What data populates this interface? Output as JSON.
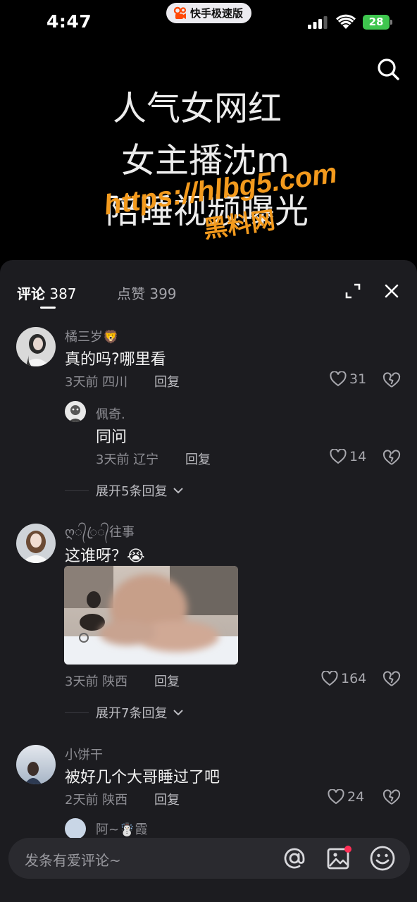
{
  "status_bar": {
    "time": "4:47",
    "app_name": "快手极速版",
    "battery": "28"
  },
  "video": {
    "lines": [
      "人气女网红",
      "女主播沈m",
      "陪睡视频曝光"
    ],
    "watermark_url": "https://hlbg5.com",
    "watermark_name": "黑料网",
    "watermark_color": "#f39a1d"
  },
  "comments_panel": {
    "tab_comments_label": "评论",
    "tab_comments_count": "387",
    "tab_likes_label": "点赞",
    "tab_likes_count": "399",
    "comments": [
      {
        "username": "橘三岁🦁",
        "text": "真的吗?哪里看",
        "meta": "3天前 四川",
        "reply_label": "回复",
        "likes": "31",
        "replies": [
          {
            "username": "佩奇.",
            "text": "同问",
            "meta": "3天前 辽宁",
            "reply_label": "回复",
            "likes": "14"
          }
        ],
        "expand_label": "展开5条回复"
      },
      {
        "username": "ღ᭄ꦿ᭄往事",
        "text": "这谁呀？😭",
        "meta": "3天前 陕西",
        "reply_label": "回复",
        "likes": "164",
        "has_image": true,
        "expand_label": "展开7条回复"
      },
      {
        "username": "小饼干",
        "text": "被好几个大哥睡过了吧",
        "meta": "2天前 陕西",
        "reply_label": "回复",
        "likes": "24"
      }
    ],
    "partial_next_username": "阿~☃️霞"
  },
  "input": {
    "placeholder": "发条有爱评论~"
  },
  "colors": {
    "panel_bg": "#1c1c20",
    "input_bg": "#2a2a2f",
    "accent_dot": "#ff2d55"
  }
}
